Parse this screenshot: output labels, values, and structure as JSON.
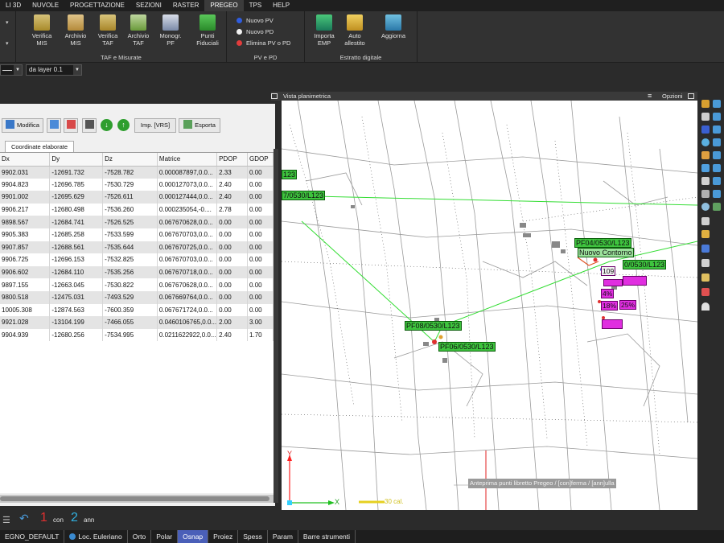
{
  "menu": [
    "LI 3D",
    "NUVOLE",
    "PROGETTAZIONE",
    "SEZIONI",
    "RASTER",
    "PREGEO",
    "TPS",
    "HELP"
  ],
  "menu_active": "PREGEO",
  "ribbon": {
    "group1": {
      "title": "TAF e Misurate",
      "buttons": [
        {
          "label": "Verifica\nMIS",
          "icon": "verify-mis-icon"
        },
        {
          "label": "Archivio\nMIS",
          "icon": "archive-mis-icon"
        },
        {
          "label": "Verifica\nTAF",
          "icon": "verify-taf-icon"
        },
        {
          "label": "Archivio\nTAF",
          "icon": "archive-taf-icon"
        },
        {
          "label": "Monogr.\nPF",
          "icon": "monograph-icon"
        },
        {
          "label": "Punti\nFiduciali",
          "icon": "fiducial-points-icon"
        }
      ]
    },
    "group2": {
      "title": "PV e PD",
      "items": [
        "Nuovo PV",
        "Nuovo PD",
        "Elimina PV o PD"
      ]
    },
    "group3": {
      "title": "Estratto digitale",
      "buttons": [
        {
          "label": "Importa\nEMP",
          "icon": "import-emp-icon"
        },
        {
          "label": "Auto\nallestito",
          "icon": "auto-build-icon"
        },
        {
          "label": "Aggiorna",
          "icon": "update-icon"
        }
      ]
    }
  },
  "subbar": {
    "layer_combo": "da layer 0.1"
  },
  "panel": {
    "buttons": {
      "modifica": "Modifica",
      "imp_vrs": "Imp. [VRS]",
      "esporta": "Esporta"
    },
    "tab": "Coordinate elaborate",
    "columns": [
      "Dx",
      "Dy",
      "Dz",
      "Matrice",
      "PDOP",
      "GDOP"
    ],
    "rows": [
      [
        "9902.031",
        "-12691.732",
        "-7528.782",
        "0.000087897,0.0...",
        "2.33",
        "0.00"
      ],
      [
        "9904.823",
        "-12696.785",
        "-7530.729",
        "0.000127073,0.0...",
        "2.40",
        "0.00"
      ],
      [
        "9901.002",
        "-12695.629",
        "-7526.611",
        "0.000127444,0.0...",
        "2.40",
        "0.00"
      ],
      [
        "9906.217",
        "-12680.498",
        "-7536.260",
        "0.000235054,-0....",
        "2.78",
        "0.00"
      ],
      [
        "9898.567",
        "-12684.741",
        "-7526.525",
        "0.067670628,0.0...",
        "0.00",
        "0.00"
      ],
      [
        "9905.383",
        "-12685.258",
        "-7533.599",
        "0.067670703,0.0...",
        "0.00",
        "0.00"
      ],
      [
        "9907.857",
        "-12688.561",
        "-7535.644",
        "0.067670725,0.0...",
        "0.00",
        "0.00"
      ],
      [
        "9906.725",
        "-12696.153",
        "-7532.825",
        "0.067670703,0.0...",
        "0.00",
        "0.00"
      ],
      [
        "9906.602",
        "-12684.110",
        "-7535.256",
        "0.067670718,0.0...",
        "0.00",
        "0.00"
      ],
      [
        "9897.155",
        "-12663.045",
        "-7530.822",
        "0.067670628,0.0...",
        "0.00",
        "0.00"
      ],
      [
        "9800.518",
        "-12475.031",
        "-7493.529",
        "0.067669764,0.0...",
        "0.00",
        "0.00"
      ],
      [
        "10005.308",
        "-12874.563",
        "-7600.359",
        "0.067671724,0.0...",
        "0.00",
        "0.00"
      ],
      [
        "9921.028",
        "-13104.199",
        "-7466.055",
        "0.0460106765,0.0...",
        "2.00",
        "3.00"
      ],
      [
        "9904.939",
        "-12680.256",
        "-7534.995",
        "0.0211622922,0.0...",
        "2.40",
        "1.70"
      ]
    ]
  },
  "view": {
    "title": "Vista planimetrica",
    "options": "Opzioni",
    "labels": {
      "pf_left1": "123",
      "pf_left2": "7/0530/L123",
      "pf_mid1": "PF08/0530/L123",
      "pf_mid2": "PF06/0530/L123",
      "pf_right1": "PF04/0530/L123",
      "contour": "Nuovo Contorno",
      "right_box": "0/0530/L123",
      "num1": "109",
      "pct1": "4%",
      "pct2": "18%",
      "pct3": "25%"
    },
    "axis_y": "Y",
    "axis_x": "X",
    "scale": "30 cal.",
    "hint": "Anteprima punti libretto Pregeo / [con]ferma / [ann]ulla"
  },
  "command": {
    "n1": "1",
    "t1": "con",
    "n2": "2",
    "t2": "ann"
  },
  "status": [
    "EGNO_DEFAULT",
    "Loc. Euleriano",
    "Orto",
    "Polar",
    "Osnap",
    "Proiez",
    "Spess",
    "Param",
    "Barre strumenti"
  ],
  "status_on": "Osnap",
  "colors": {
    "ribbon": "#323232",
    "accent": "#4a5fb8",
    "green_label": "#3ec43e",
    "magenta_label": "#e02ee0",
    "trace": "#33dd33"
  }
}
